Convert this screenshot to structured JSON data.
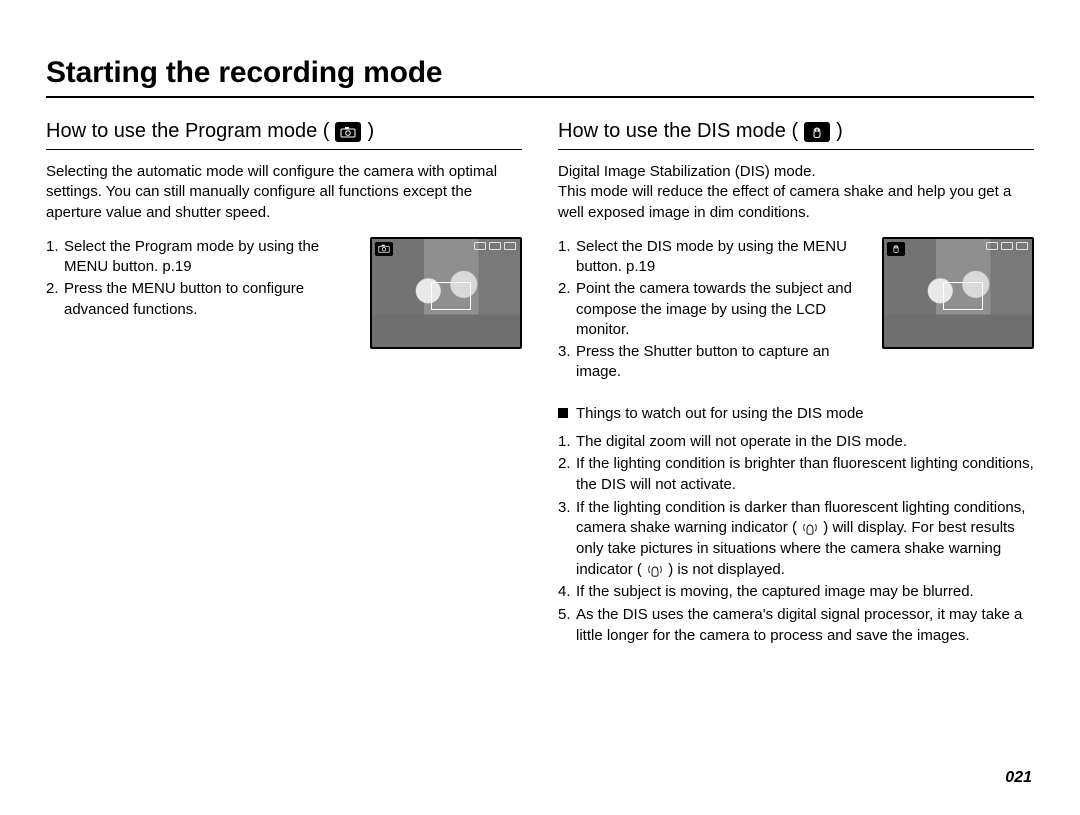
{
  "page": {
    "title": "Starting the recording mode",
    "number": "021"
  },
  "left": {
    "heading_prefix": "How to use the Program mode (",
    "heading_suffix": " )",
    "icon_name": "program-mode-icon",
    "intro": "Selecting the automatic mode will configure the camera with optimal settings. You can still manually configure all functions except the aperture value and shutter speed.",
    "steps": [
      "Select the Program mode by using the MENU button. p.19",
      "Press the MENU button to configure advanced functions."
    ],
    "lcd_icon": "program-mode-icon"
  },
  "right": {
    "heading_prefix": "How to use the DIS mode (",
    "heading_suffix": " )",
    "icon_name": "dis-mode-icon",
    "intro": "Digital Image Stabilization (DIS) mode.\nThis mode will reduce the effect of camera shake and help you get a well exposed image in dim conditions.",
    "steps": [
      "Select the DIS mode by using the MENU button. p.19",
      "Point the camera towards the subject and compose the image by using the LCD monitor.",
      "Press the Shutter button to capture an image."
    ],
    "lcd_icon": "dis-mode-icon",
    "notes_heading": "Things to watch out for using the DIS mode",
    "notes": [
      {
        "pre": "The digital zoom will not operate in the DIS mode."
      },
      {
        "pre": "If the lighting condition is brighter than fluorescent lighting conditions, the DIS will not activate."
      },
      {
        "pre": "If the lighting condition is darker than fluorescent lighting conditions, camera shake warning indicator (",
        "icon": "shake-warning-icon",
        "mid": " ) will display. For best results only take pictures in situations where the camera shake warning indicator (",
        "icon2": "shake-warning-icon",
        "post": " ) is not displayed."
      },
      {
        "pre": "If the subject is moving, the captured image may be blurred."
      },
      {
        "pre": "As the DIS uses the camera's digital signal processor, it may take a little longer for the camera to process and save the images."
      }
    ]
  }
}
